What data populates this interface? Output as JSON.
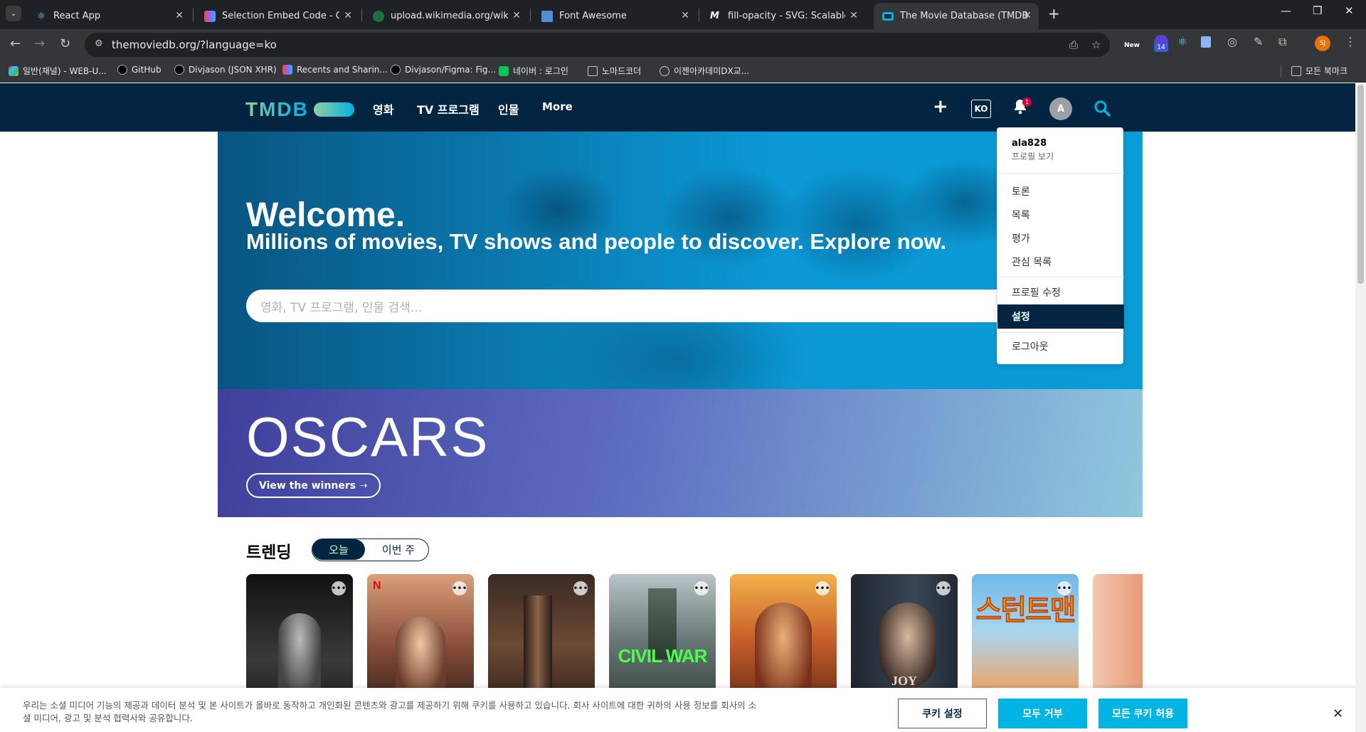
{
  "browser": {
    "tabs": [
      {
        "title": "React App",
        "icon": "react-icon",
        "color": "#61dafb"
      },
      {
        "title": "Selection Embed Code - Goo",
        "icon": "figma-icon",
        "color": "#a259ff"
      },
      {
        "title": "upload.wikimedia.org/wikipedi",
        "icon": "globe-icon",
        "color": "#f4b400"
      },
      {
        "title": "Font Awesome",
        "icon": "flag-icon",
        "color": "#528dd7"
      },
      {
        "title": "fill-opacity - SVG: Scalable Vec",
        "icon": "mdn-icon",
        "color": "#ffffff"
      },
      {
        "title": "The Movie Database (TMDB)",
        "icon": "tmdb-icon",
        "color": "#01b4e4"
      }
    ],
    "url": "themoviedb.org/?language=ko",
    "bookmarks": [
      {
        "label": "일반(채널) - WEB-U...",
        "icon": "slack-icon"
      },
      {
        "label": "GitHub",
        "icon": "github-icon"
      },
      {
        "label": "Divjason (JSON XHR)",
        "icon": "github-icon"
      },
      {
        "label": "Recents and Sharin...",
        "icon": "figma-icon"
      },
      {
        "label": "Divjason/Figma: Fig...",
        "icon": "github-icon"
      },
      {
        "label": "네이버 : 로그인",
        "icon": "naver-icon"
      },
      {
        "label": "노마드코더",
        "icon": "folder-icon"
      },
      {
        "label": "이젠아카데미DX교...",
        "icon": "globe-icon"
      }
    ],
    "all_bookmarks": "모든 북마크",
    "ext_badge": "14",
    "ext_new": "New",
    "profile_initials": "SJ"
  },
  "header": {
    "logo_text": "TMDB",
    "nav": [
      "영화",
      "TV 프로그램",
      "인물",
      "More"
    ],
    "lang": "KO",
    "notification_count": "1",
    "avatar_letter": "A"
  },
  "hero": {
    "title": "Welcome.",
    "subtitle": "Millions of movies, TV shows and people to discover. Explore now.",
    "search_placeholder": "영화, TV 프로그램, 인물 검색..."
  },
  "oscars": {
    "logo": "OSCARS",
    "button": "View the winners ➝"
  },
  "trending": {
    "title": "트렌딩",
    "toggle": [
      "오늘",
      "이번 주"
    ],
    "posters": [
      {
        "text": ""
      },
      {
        "text": ""
      },
      {
        "text": ""
      },
      {
        "text": "CIVIL WAR"
      },
      {
        "text": ""
      },
      {
        "text": "JOY"
      },
      {
        "text": "스턴트맨"
      },
      {
        "text": ""
      }
    ]
  },
  "dropdown": {
    "username": "ala828",
    "view_profile": "프로필 보기",
    "items_group1": [
      "토론",
      "목록",
      "평가",
      "관심 목록"
    ],
    "items_group2": [
      "프로필 수정",
      "설정"
    ],
    "logout": "로그아웃"
  },
  "cookie": {
    "text": "우리는 소셜 미디어 기능의 제공과 데이터 분석 및 본 사이트가 올바로 동작하고 개인화된 콘텐츠와 광고를 제공하기 위해 쿠키를 사용하고 있습니다. 회사 사이트에 대한 귀하의 사용 정보를 회사의 소셜 미디어, 광고 및 분석 협력사와 공유합니다.",
    "settings": "쿠키 설정",
    "reject": "모두 거부",
    "accept": "모든 쿠키 허용"
  }
}
